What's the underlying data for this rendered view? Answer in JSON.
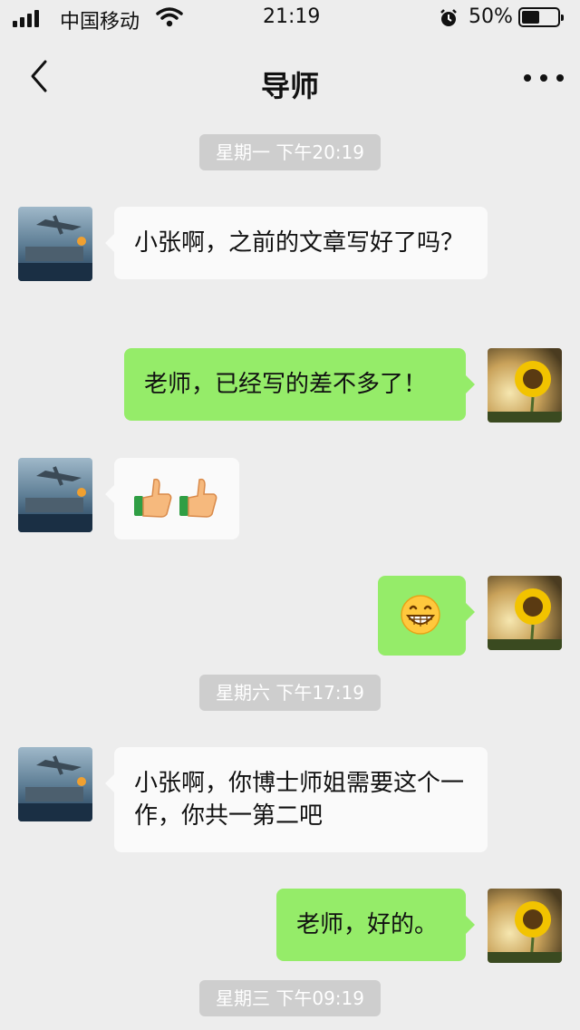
{
  "status_bar": {
    "carrier": "中国移动",
    "time": "21:19",
    "battery_percent": "50%",
    "battery_level": 0.5
  },
  "nav": {
    "title": "导师",
    "back_icon": "chevron-left-icon",
    "more_icon": "more-dots-icon"
  },
  "messages": [
    {
      "type": "timestamp",
      "text": "星期一 下午20:19"
    },
    {
      "type": "received",
      "text": "小张啊，之前的文章写好了吗？"
    },
    {
      "type": "sent",
      "text": "老师，已经写的差不多了！"
    },
    {
      "type": "received",
      "emoji": [
        "thumbs-up-icon",
        "thumbs-up-icon"
      ]
    },
    {
      "type": "sent",
      "emoji": [
        "grinning-face-icon"
      ]
    },
    {
      "type": "timestamp",
      "text": "星期六 下午17:19"
    },
    {
      "type": "received",
      "text": "小张啊，你博士师姐需要这个一作，你共一第二吧"
    },
    {
      "type": "sent",
      "text": "老师，好的。"
    },
    {
      "type": "timestamp",
      "text": "星期三 下午09:19"
    }
  ],
  "colors": {
    "background": "#ededed",
    "sent_bubble": "#95ec69",
    "received_bubble": "#fafafa",
    "timestamp_bg": "#cecece"
  }
}
